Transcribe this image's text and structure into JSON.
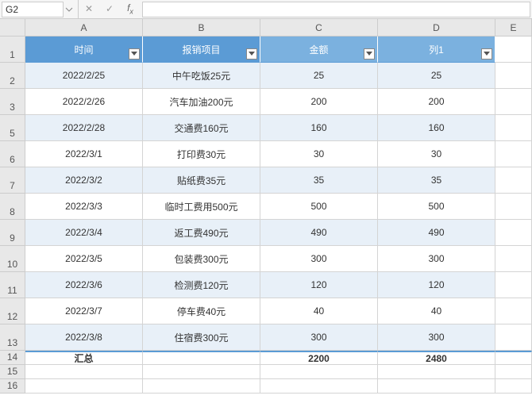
{
  "name_box": "G2",
  "columns": [
    "A",
    "B",
    "C",
    "D",
    "E"
  ],
  "row_numbers": [
    "1",
    "2",
    "3",
    "5",
    "6",
    "7",
    "8",
    "9",
    "10",
    "11",
    "12",
    "13",
    "14",
    "15",
    "16"
  ],
  "headers": {
    "c1": "时间",
    "c2": "报销项目",
    "c3": "金额",
    "c4": "列1"
  },
  "rows": [
    {
      "c1": "2022/2/25",
      "c2": "中午吃饭25元",
      "c3": "25",
      "c4": "25"
    },
    {
      "c1": "2022/2/26",
      "c2": "汽车加油200元",
      "c3": "200",
      "c4": "200"
    },
    {
      "c1": "2022/2/28",
      "c2": "交通费160元",
      "c3": "160",
      "c4": "160"
    },
    {
      "c1": "2022/3/1",
      "c2": "打印费30元",
      "c3": "30",
      "c4": "30"
    },
    {
      "c1": "2022/3/2",
      "c2": "贴纸费35元",
      "c3": "35",
      "c4": "35"
    },
    {
      "c1": "2022/3/3",
      "c2": "临时工费用500元",
      "c3": "500",
      "c4": "500"
    },
    {
      "c1": "2022/3/4",
      "c2": "返工费490元",
      "c3": "490",
      "c4": "490"
    },
    {
      "c1": "2022/3/5",
      "c2": "包装费300元",
      "c3": "300",
      "c4": "300"
    },
    {
      "c1": "2022/3/6",
      "c2": "检测费120元",
      "c3": "120",
      "c4": "120"
    },
    {
      "c1": "2022/3/7",
      "c2": "停车费40元",
      "c3": "40",
      "c4": "40"
    },
    {
      "c1": "2022/3/8",
      "c2": "住宿费300元",
      "c3": "300",
      "c4": "300"
    }
  ],
  "total": {
    "label": "汇总",
    "c3": "2200",
    "c4": "2480"
  },
  "chart_data": {
    "type": "table",
    "title": "",
    "columns": [
      "时间",
      "报销项目",
      "金额",
      "列1"
    ],
    "rows": [
      [
        "2022/2/25",
        "中午吃饭25元",
        25,
        25
      ],
      [
        "2022/2/26",
        "汽车加油200元",
        200,
        200
      ],
      [
        "2022/2/28",
        "交通费160元",
        160,
        160
      ],
      [
        "2022/3/1",
        "打印费30元",
        30,
        30
      ],
      [
        "2022/3/2",
        "贴纸费35元",
        35,
        35
      ],
      [
        "2022/3/3",
        "临时工费用500元",
        500,
        500
      ],
      [
        "2022/3/4",
        "返工费490元",
        490,
        490
      ],
      [
        "2022/3/5",
        "包装费300元",
        300,
        300
      ],
      [
        "2022/3/6",
        "检测费120元",
        120,
        120
      ],
      [
        "2022/3/7",
        "停车费40元",
        40,
        40
      ],
      [
        "2022/3/8",
        "住宿费300元",
        300,
        300
      ]
    ],
    "totals": {
      "金额": 2200,
      "列1": 2480
    }
  }
}
